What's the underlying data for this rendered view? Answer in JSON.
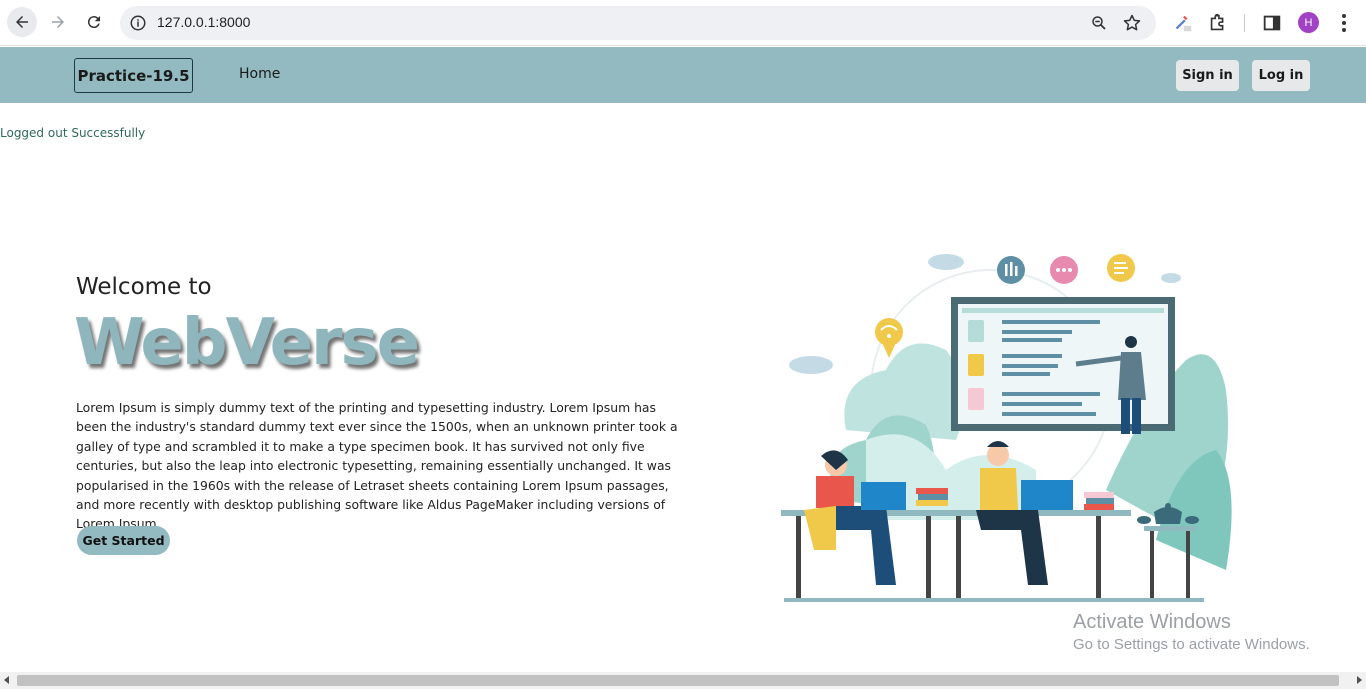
{
  "browser": {
    "url": "127.0.0.1:8000",
    "profile_initial": "H",
    "icons": [
      "back-arrow-icon",
      "forward-arrow-icon",
      "reload-icon",
      "site-info-icon",
      "zoom-icon",
      "bookmark-star-icon",
      "extension-icon",
      "puzzle-icon",
      "side-panel-icon",
      "kebab-menu-icon"
    ]
  },
  "navbar": {
    "brand": "Practice-19.5",
    "home": "Home",
    "sign_in": "Sign in",
    "log_in": "Log in"
  },
  "alert": "Logged out Successfully",
  "hero": {
    "welcome": "Welcome to",
    "title": "WebVerse",
    "body": "Lorem Ipsum is simply dummy text of the printing and typesetting industry. Lorem Ipsum has been the industry's standard dummy text ever since the 1500s, when an unknown printer took a galley of type and scrambled it to make a type specimen book. It has survived not only five centuries, but also the leap into electronic typesetting, remaining essentially unchanged. It was popularised in the 1960s with the release of Letraset sheets containing Lorem Ipsum passages, and more recently with desktop publishing software like Aldus PageMaker including versions of Lorem Ipsum.",
    "cta": "Get Started"
  },
  "watermark": {
    "title": "Activate Windows",
    "subtitle": "Go to Settings to activate Windows."
  },
  "colors": {
    "navbar": "#93bac1",
    "accent": "#8fb6bd",
    "alert_text": "#2e6b57"
  }
}
